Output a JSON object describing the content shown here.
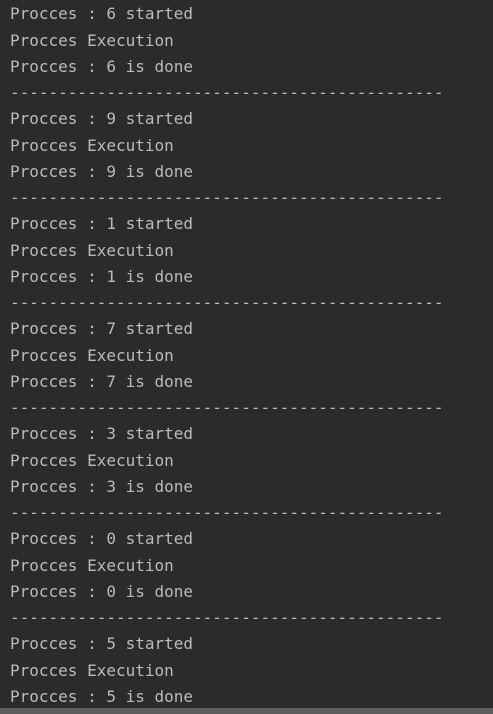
{
  "console": {
    "lines": [
      "Procces : 6 started",
      "Procces Execution",
      "Procces : 6 is done",
      "---------------------------------------------",
      "Procces : 9 started",
      "Procces Execution",
      "Procces : 9 is done",
      "---------------------------------------------",
      "Procces : 1 started",
      "Procces Execution",
      "Procces : 1 is done",
      "---------------------------------------------",
      "Procces : 7 started",
      "Procces Execution",
      "Procces : 7 is done",
      "---------------------------------------------",
      "Procces : 3 started",
      "Procces Execution",
      "Procces : 3 is done",
      "---------------------------------------------",
      "Procces : 0 started",
      "Procces Execution",
      "Procces : 0 is done",
      "---------------------------------------------",
      "Procces : 5 started",
      "Procces Execution",
      "Procces : 5 is done"
    ]
  },
  "colors": {
    "background": "#2b2b2b",
    "text": "#bbbbbb"
  }
}
